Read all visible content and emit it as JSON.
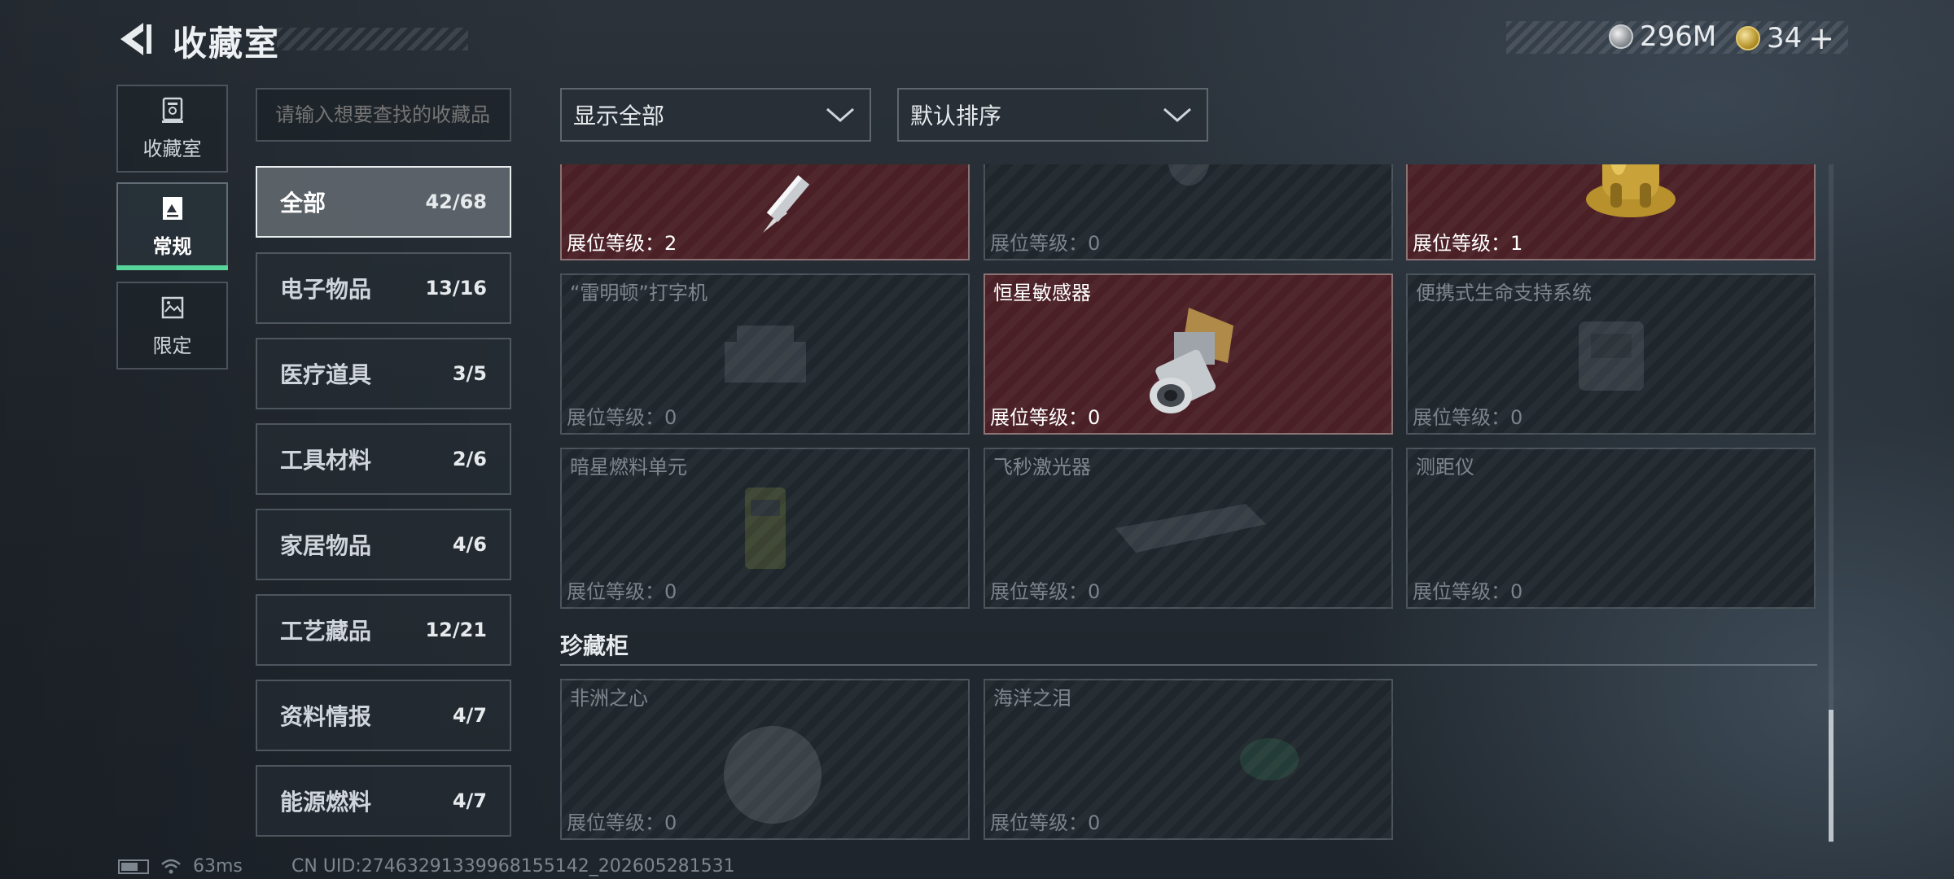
{
  "header": {
    "title": "收藏室",
    "currency": [
      {
        "icon": "silver-coin-icon",
        "value": "296M"
      },
      {
        "icon": "gold-coin-icon",
        "value": "34"
      }
    ],
    "plus_label": "+"
  },
  "rail": [
    {
      "label": "收藏室",
      "icon": "trophy-icon",
      "active": false
    },
    {
      "label": "常规",
      "icon": "document-icon",
      "active": true
    },
    {
      "label": "限定",
      "icon": "image-icon",
      "active": false
    }
  ],
  "search": {
    "placeholder": "请输入想要查找的收藏品"
  },
  "categories": [
    {
      "name": "全部",
      "count": "42/68",
      "active": true
    },
    {
      "name": "电子物品",
      "count": "13/16"
    },
    {
      "name": "医疗道具",
      "count": "3/5"
    },
    {
      "name": "工具材料",
      "count": "2/6"
    },
    {
      "name": "家居物品",
      "count": "4/6"
    },
    {
      "name": "工艺藏品",
      "count": "12/21"
    },
    {
      "name": "资料情报",
      "count": "4/7"
    },
    {
      "name": "能源燃料",
      "count": "4/7"
    }
  ],
  "filters": {
    "show": "显示全部",
    "sort": "默认排序"
  },
  "items": [
    {
      "name": "",
      "level": "展位等级：2",
      "owned": true,
      "art": "pen"
    },
    {
      "name": "",
      "level": "展位等级：0",
      "owned": false,
      "art": "vase"
    },
    {
      "name": "",
      "level": "展位等级：1",
      "owned": true,
      "art": "statue"
    },
    {
      "name": "“雷明顿”打字机",
      "level": "展位等级：0",
      "owned": false,
      "art": "typewriter"
    },
    {
      "name": "恒星敏感器",
      "level": "展位等级：0",
      "owned": true,
      "art": "sensor"
    },
    {
      "name": "便携式生命支持系统",
      "level": "展位等级：0",
      "owned": false,
      "art": "pack"
    },
    {
      "name": "暗星燃料单元",
      "level": "展位等级：0",
      "owned": false,
      "art": "fuel"
    },
    {
      "name": "飞秒激光器",
      "level": "展位等级：0",
      "owned": false,
      "art": "laser"
    },
    {
      "name": "测距仪",
      "level": "展位等级：0",
      "owned": false,
      "art": "none"
    }
  ],
  "showcase": {
    "title": "珍藏柜",
    "items": [
      {
        "name": "非洲之心",
        "level": "展位等级：0",
        "owned": false,
        "art": "gem"
      },
      {
        "name": "海洋之泪",
        "level": "展位等级：0",
        "owned": false,
        "art": "tear"
      }
    ]
  },
  "status": {
    "ping": "63ms",
    "uid": "CN UID:27463291339968155142_202605281531"
  },
  "colors": {
    "accent": "#56d49a",
    "owned_card": "#4a2026",
    "empty_card": "#1f262c"
  }
}
